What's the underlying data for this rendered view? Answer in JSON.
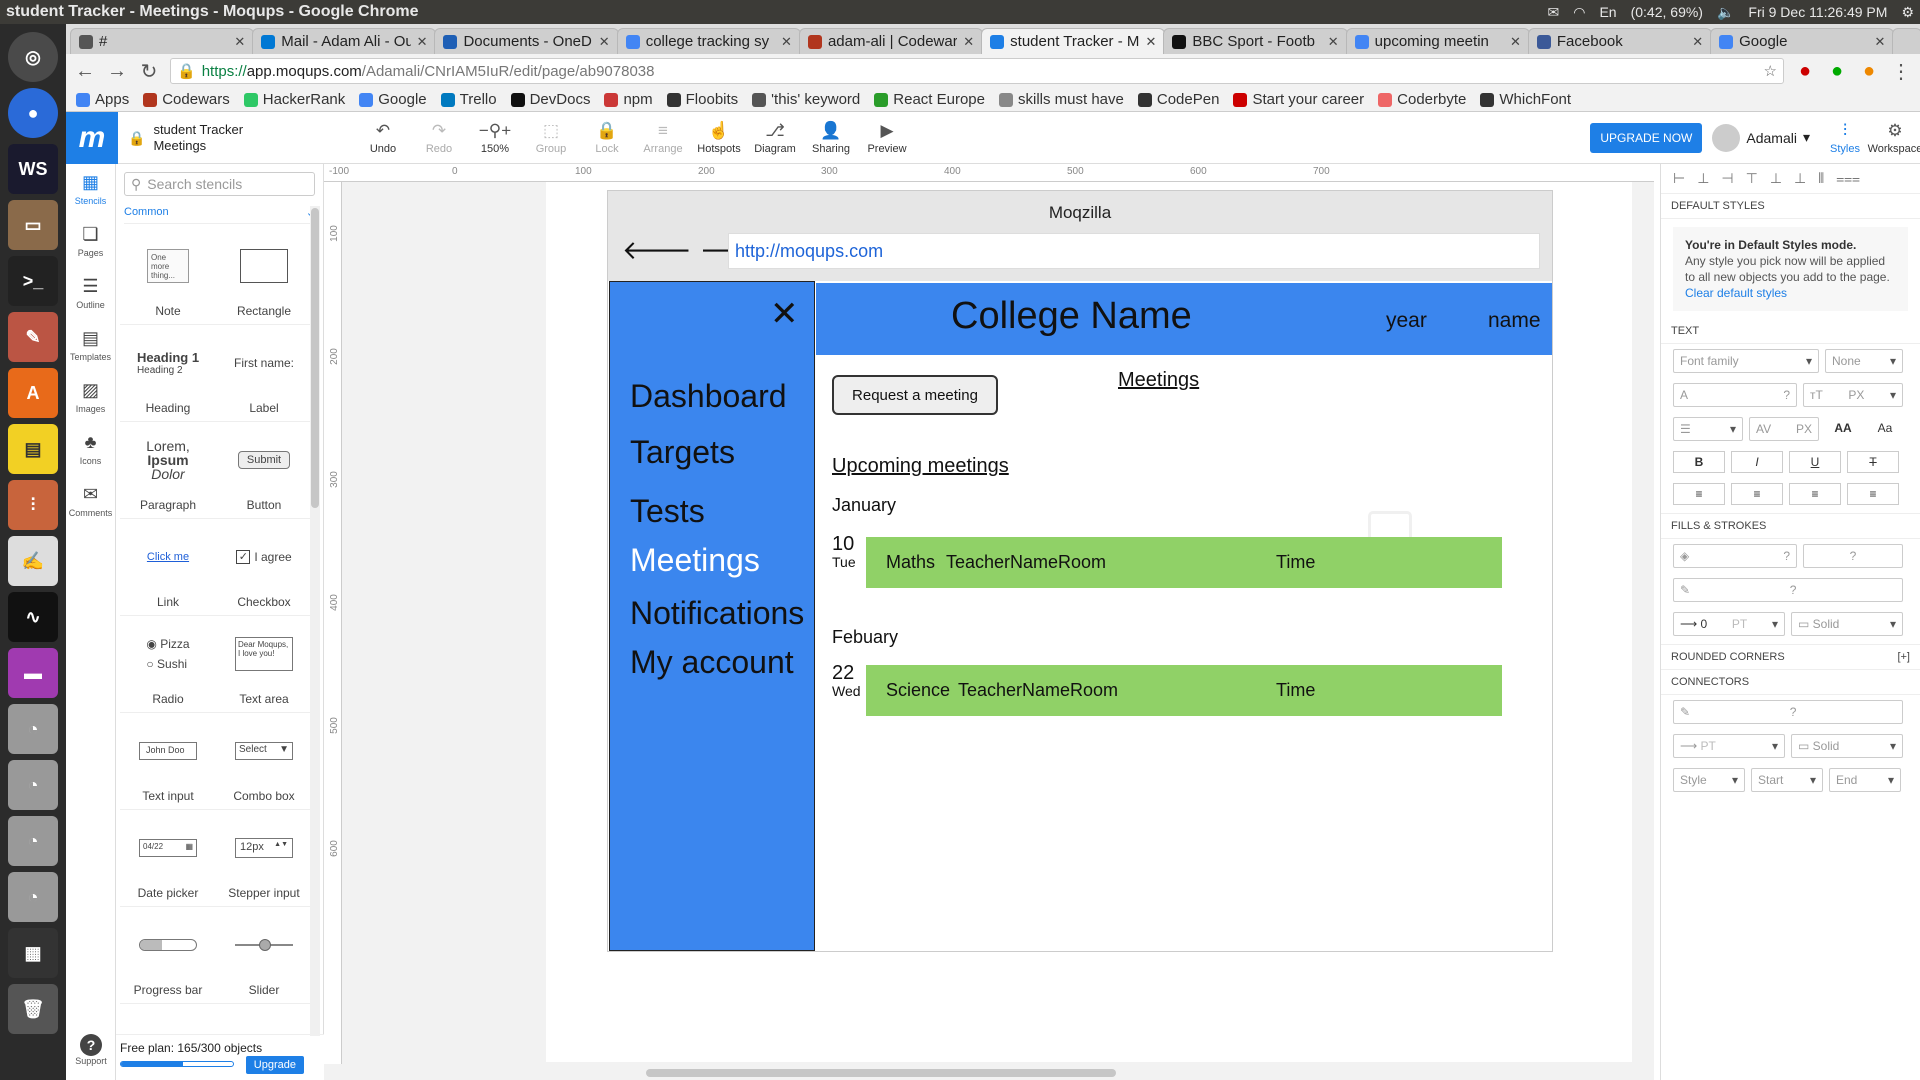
{
  "os": {
    "window_title": "student Tracker - Meetings - Moqups - Google Chrome",
    "battery": "(0:42, 69%)",
    "clock": "Fri 9 Dec 11:26:49 PM",
    "keyboard": "En"
  },
  "tabs": [
    {
      "label": "#",
      "color": "#555"
    },
    {
      "label": "Mail - Adam Ali - Ou",
      "color": "#0078d4"
    },
    {
      "label": "Documents - OneD",
      "color": "#1e5fb5"
    },
    {
      "label": "college tracking sy",
      "color": "#4285f4"
    },
    {
      "label": "adam-ali | Codewar",
      "color": "#b1361e"
    },
    {
      "label": "student Tracker - M",
      "color": "#1e7fe6",
      "active": true
    },
    {
      "label": "BBC Sport - Footb",
      "color": "#111"
    },
    {
      "label": "upcoming meetin",
      "color": "#4285f4"
    },
    {
      "label": "Facebook",
      "color": "#3b5998"
    },
    {
      "label": "Google",
      "color": "#4285f4"
    }
  ],
  "address": {
    "https": "https://",
    "host": "app.moqups.com",
    "path": "/Adamali/CNrIAM5IuR/edit/page/ab9078038"
  },
  "bookmarks": [
    "Apps",
    "Codewars",
    "HackerRank",
    "Google",
    "Trello",
    "DevDocs",
    "npm",
    "Floobits",
    "'this' keyword",
    "React Europe",
    "skills must have",
    "CodePen",
    "Start your career",
    "Coderbyte",
    "WhichFont"
  ],
  "moqups": {
    "project": "student Tracker",
    "page": "Meetings",
    "tools": [
      {
        "label": "Undo",
        "icon": "↶",
        "dim": false
      },
      {
        "label": "Redo",
        "icon": "↷",
        "dim": true
      },
      {
        "label": "150%",
        "icon": "−⚲+",
        "dim": false
      },
      {
        "label": "Group",
        "icon": "⬚",
        "dim": true
      },
      {
        "label": "Lock",
        "icon": "🔒",
        "dim": true
      },
      {
        "label": "Arrange",
        "icon": "≡",
        "dim": true
      },
      {
        "label": "Hotspots",
        "icon": "☝",
        "dim": false
      },
      {
        "label": "Diagram",
        "icon": "⎇",
        "dim": false
      },
      {
        "label": "Sharing",
        "icon": "👤",
        "dim": false
      },
      {
        "label": "Preview",
        "icon": "▶",
        "dim": false
      }
    ],
    "upgrade_now": "UPGRADE NOW",
    "user": "Adamali",
    "right_tools": [
      {
        "label": "Styles",
        "icon": "⚙"
      },
      {
        "label": "Workspace",
        "icon": "⚙"
      }
    ]
  },
  "rail": [
    {
      "label": "Stencils",
      "icon": "▦",
      "active": true
    },
    {
      "label": "Pages",
      "icon": "❏"
    },
    {
      "label": "Outline",
      "icon": "☰"
    },
    {
      "label": "Templates",
      "icon": "▤"
    },
    {
      "label": "Images",
      "icon": "▨"
    },
    {
      "label": "Icons",
      "icon": "♣"
    },
    {
      "label": "Comments",
      "icon": "✉"
    }
  ],
  "rail_support": "Support",
  "stencils": {
    "search_placeholder": "Search stencils",
    "category": "Common",
    "items": [
      "Note",
      "Rectangle",
      "Heading",
      "Label",
      "Paragraph",
      "Button",
      "Link",
      "Checkbox",
      "Radio",
      "Text area",
      "Text input",
      "Combo box",
      "Date picker",
      "Stepper input",
      "Progress bar",
      "Slider"
    ],
    "note_text": "One more thing...",
    "heading1": "Heading 1",
    "heading2": "Heading 2",
    "label_text": "First name:",
    "para1": "Lorem,",
    "para2": "Ipsum",
    "para3": "Dolor",
    "button_text": "Submit",
    "link_text": "Click me",
    "checkbox_text": "I agree",
    "radio1": "Pizza",
    "radio2": "Sushi",
    "textarea_text": "Dear Moqups, I love you!",
    "textinput_text": "John Doo",
    "combo_text": "Select",
    "date_text": "04/22",
    "stepper_text": "12px",
    "plan_text": "Free plan: 165/300 objects",
    "plan_fraction": 0.55,
    "upgrade": "Upgrade"
  },
  "ruler_h": [
    "-100",
    "0",
    "100",
    "200",
    "300",
    "400",
    "500",
    "600",
    "700"
  ],
  "ruler_v": [
    "100",
    "200",
    "300",
    "400",
    "500",
    "600"
  ],
  "mockup": {
    "browser_title": "Moqzilla",
    "url": "http://moqups.com",
    "nav": [
      "Dashboard",
      "Targets",
      "Tests",
      "Meetings",
      "Notifications",
      "My account"
    ],
    "college": "College Name",
    "year": "year",
    "name": "name",
    "request_btn": "Request a meeting",
    "meetings_title": "Meetings",
    "upcoming": "Upcoming meetings",
    "groups": [
      {
        "month": "January",
        "day": "10",
        "weekday": "Tue",
        "subject": "Maths",
        "teacher": "TeacherName",
        "room": "Room",
        "time": "Time"
      },
      {
        "month": "Febuary",
        "day": "22",
        "weekday": "Wed",
        "subject": "Science",
        "teacher": "TeacherName",
        "room": "Room",
        "time": "Time"
      }
    ]
  },
  "rightpanel": {
    "default_styles": "DEFAULT STYLES",
    "mode_title": "You're in Default Styles mode.",
    "mode_text": "Any style you pick now will be applied to all new objects you add to the page.",
    "clear": "Clear default styles",
    "text": "TEXT",
    "font_family": "Font family",
    "none": "None",
    "fills": "FILLS & STROKES",
    "stroke_val": "0",
    "solid": "Solid",
    "rounded": "ROUNDED CORNERS",
    "plus": "[+]",
    "connectors": "CONNECTORS",
    "style": "Style",
    "start": "Start",
    "end": "End",
    "q": "?",
    "px": "PX",
    "pt": "PT"
  }
}
